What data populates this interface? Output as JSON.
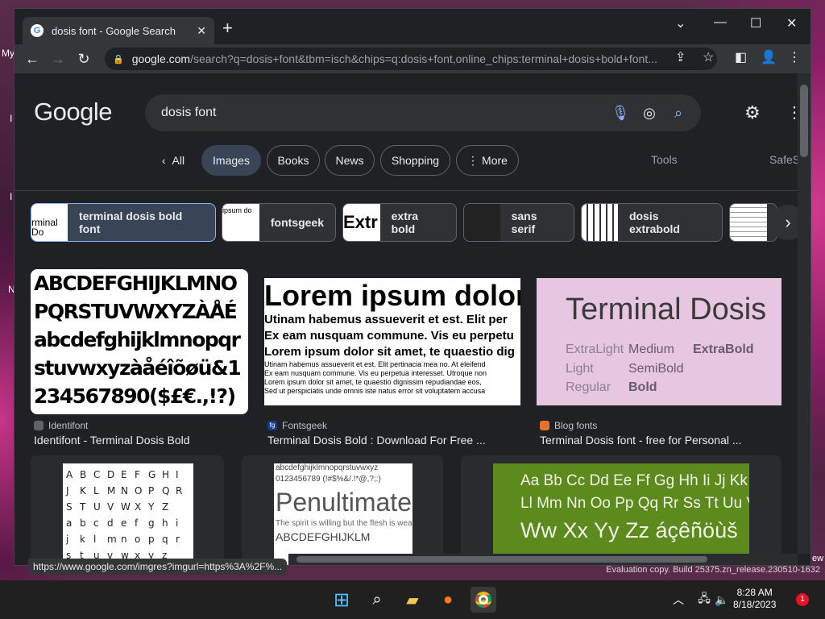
{
  "desktop": {
    "labels": [
      "My",
      "N",
      "I",
      "I"
    ],
    "watermark": "Evaluation copy. Build 25375.zn_release.230510-1632",
    "right_edge_text": "ew"
  },
  "browser": {
    "tab_title": "dosis font - Google Search",
    "favicon": "G",
    "url_host": "google.com",
    "url_rest": "/search?q=dosis+font&tbm=isch&chips=q:dosis+font,online_chips:terminal+dosis+bold+font...",
    "status_url": "https://www.google.com/imgres?imgurl=https%3A%2F%..."
  },
  "google": {
    "logo": "Google",
    "query": "dosis font",
    "nav": [
      "All",
      "Images",
      "Books",
      "News",
      "Shopping",
      "More"
    ],
    "tools": "Tools",
    "safesearch": "SafeS",
    "refine_chips": [
      {
        "label": "terminal dosis bold font",
        "thumb": "rminal Do"
      },
      {
        "label": "fontsgeek",
        "thumb": "ipsum do"
      },
      {
        "label": "extra bold",
        "thumb": "Extr"
      },
      {
        "label": "sans serif",
        "thumb": ""
      },
      {
        "label": "dosis extrabold",
        "thumb": ""
      }
    ]
  },
  "results": [
    {
      "source": "Identifont",
      "title": "Identifont - Terminal Dosis Bold",
      "lines": [
        "ABCDEFGHIJKLMNO",
        "PQRSTUVWXYZÀÅÉ",
        "abcdefghijklmnopqr",
        "stuvwxyzàåéîõøü&1",
        "234567890($£€.,!?)"
      ]
    },
    {
      "source": "Fontsgeek",
      "title": "Terminal Dosis Bold : Download For Free ...",
      "big": "Lorem ipsum dolor s",
      "mid": [
        "Utinam habemus assueverit et est. Elit per",
        "Ex eam nusquam commune. Vis eu perpetu",
        "Lorem ipsum dolor sit amet, te quaestio dig"
      ],
      "small": [
        "Utinam habemus assueverit et est. Elit pertinacia mea no. At eleifend",
        "Ex eam nusquam commune. Vis eu perpetua interesset. Utroque non",
        "Lorem ipsum dolor sit amet, te quaestio dignissim repudiandae eos,",
        "Sed ut perspiciatis unde omnis iste natus error sit voluptatem accusa"
      ]
    },
    {
      "source": "Blog fonts",
      "title": "Terminal Dosis font - free for Personal ...",
      "heading": "Terminal Dosis",
      "weights": [
        "ExtraLight",
        "Medium",
        "ExtraBold",
        "Light",
        "SemiBold",
        "Regular",
        "Bold"
      ]
    }
  ],
  "row2": {
    "grid": [
      [
        "A",
        "B",
        "C",
        "D",
        "E",
        "F",
        "G",
        "H",
        "I"
      ],
      [
        "J",
        "K",
        "L",
        "M",
        "N",
        "O",
        "P",
        "Q",
        "R"
      ],
      [
        "S",
        "T",
        "U",
        "V",
        "W",
        "X",
        "Y",
        "Z",
        ""
      ],
      [
        "a",
        "b",
        "c",
        "d",
        "e",
        "f",
        "g",
        "h",
        "i"
      ],
      [
        "j",
        "k",
        "l",
        "m",
        "n",
        "o",
        "p",
        "q",
        "r"
      ],
      [
        "s",
        "t",
        "u",
        "v",
        "w",
        "x",
        "y",
        "z",
        ""
      ]
    ],
    "specimen": [
      "abcdefghijklmnopqrstuvwxyz",
      "0123456789 (!#$%&/.!*@,?;:)",
      "Penultimate",
      "The spirit is willing but the flesh is weak",
      "ABCDEFGHIJKLM"
    ],
    "green": [
      "Aa Bb Cc Dd Ee Ff Gg Hh Ii Jj Kk",
      "Ll Mm Nn Oo Pp Qq Rr Ss Tt Uu Vv",
      "Ww Xx Yy Zz áçêñöùš"
    ]
  },
  "taskbar": {
    "time": "8:28 AM",
    "date": "8/18/2023",
    "notifications": "1"
  }
}
